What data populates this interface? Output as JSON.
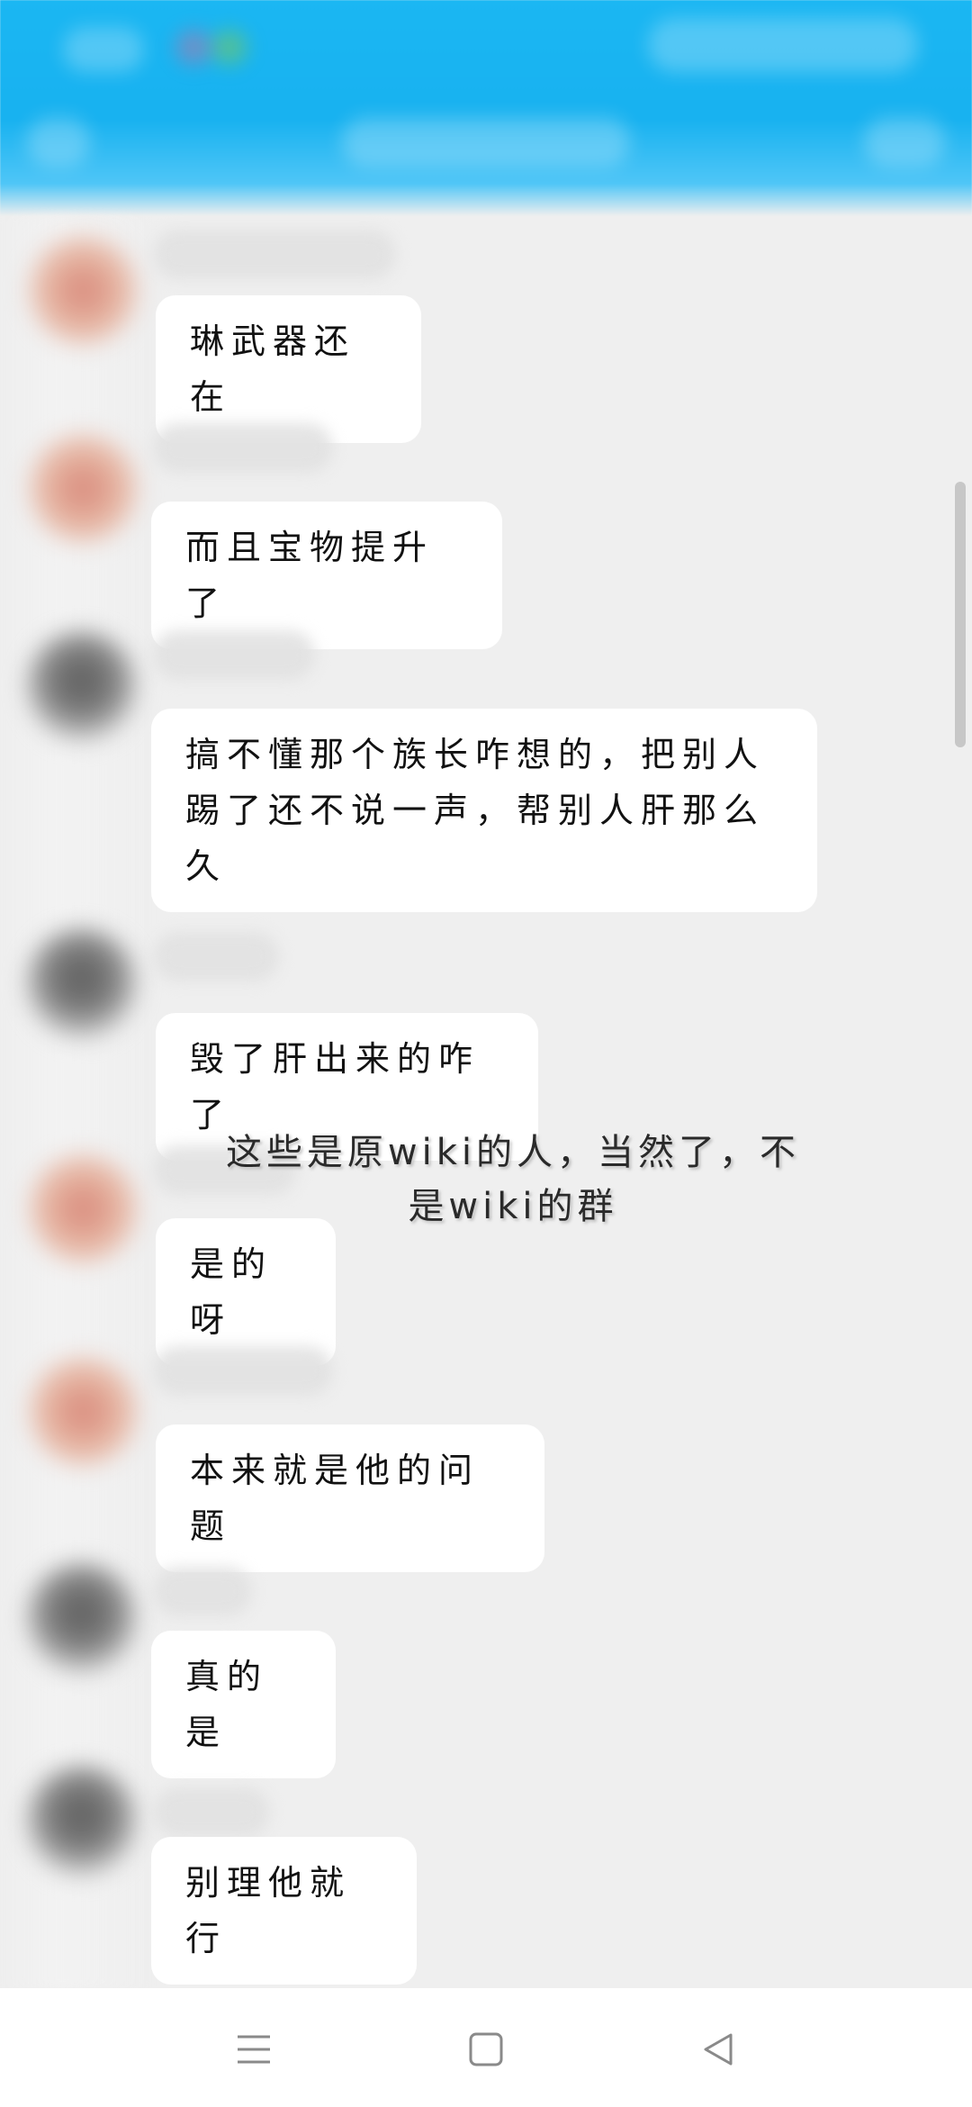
{
  "chat": {
    "messages": [
      {
        "text": "琳武器还在"
      },
      {
        "text": "而且宝物提升了"
      },
      {
        "text": "搞不懂那个族长咋想的，把别人\n踢了还不说一声，帮别人肝那么\n久"
      },
      {
        "text": "毁了肝出来的咋了"
      },
      {
        "text": "是的呀"
      },
      {
        "text": "本来就是他的问题"
      },
      {
        "text": "真的是"
      },
      {
        "text": "别理他就行"
      }
    ]
  },
  "overlay": {
    "caption": "这些是原wiki的人，当然了，不\n是wiki的群"
  },
  "navbar": {
    "icons": [
      "menu-icon",
      "home-square-icon",
      "back-triangle-icon"
    ]
  },
  "colors": {
    "header": "#18b2f0",
    "background": "#efefef",
    "bubble": "#ffffff"
  }
}
